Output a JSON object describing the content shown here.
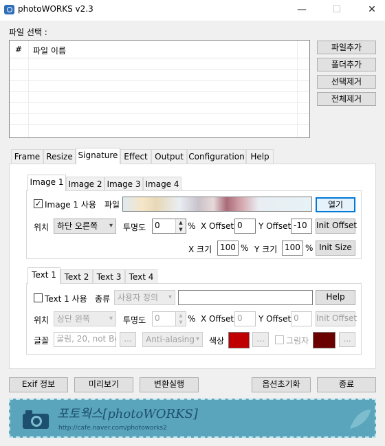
{
  "window": {
    "title": "photoWORKS v2.3",
    "controls": [
      "—",
      "☐",
      "✕"
    ]
  },
  "file_section": {
    "label": "파일 선택 :",
    "columns": [
      "#",
      "파일 이름"
    ],
    "buttons": [
      "파일추가",
      "폴더추가",
      "선택제거",
      "전체제거"
    ]
  },
  "main_tabs": [
    "Frame",
    "Resize",
    "Signature",
    "Effect",
    "Output",
    "Configuration",
    "Help"
  ],
  "image_tabs": [
    "Image 1",
    "Image 2",
    "Image 3",
    "Image 4"
  ],
  "image": {
    "use_label": "Image 1 사용",
    "use_checked": true,
    "file_label": "파일",
    "open_button": "열기",
    "position_label": "위치",
    "position_value": "하단 오른쪽",
    "opacity_label": "투명도",
    "opacity_value": "0",
    "percent": "%",
    "x_offset_label": "X Offset",
    "x_offset_value": "0",
    "y_offset_label": "Y Offset",
    "y_offset_value": "-10",
    "init_offset_button": "Init Offset",
    "x_size_label": "X 크기",
    "x_size_value": "100",
    "y_size_label": "Y 크기",
    "y_size_value": "100",
    "init_size_button": "Init Size"
  },
  "text_tabs": [
    "Text 1",
    "Text 2",
    "Text 3",
    "Text 4"
  ],
  "text": {
    "use_label": "Text 1 사용",
    "type_label": "종류",
    "type_value": "사용자 정의",
    "help_button": "Help",
    "position_label": "위치",
    "position_value": "상단 왼쪽",
    "opacity_label": "투명도",
    "opacity_value": "0",
    "percent": "%",
    "x_offset_label": "X Offset",
    "x_offset_value": "0",
    "y_offset_label": "Y Offset",
    "y_offset_value": "0",
    "init_offset_button": "Init Offset",
    "font_label": "글꼴",
    "font_value": "굴림, 20, not Bo",
    "ellipsis": "...",
    "antialias_value": "Anti-alasing",
    "color_label": "색상",
    "color": "#c00000",
    "shadow_label": "그림자",
    "shadow_color": "#6b0000"
  },
  "bottom_buttons": [
    "Exif 정보",
    "미리보기",
    "변환실행",
    "옵션초기화",
    "종료"
  ],
  "banner": {
    "title": "포토웍스[photoWORKS]",
    "url": "http://cafe.naver.com/photoworks2",
    "bg": "#5aa5bb"
  }
}
